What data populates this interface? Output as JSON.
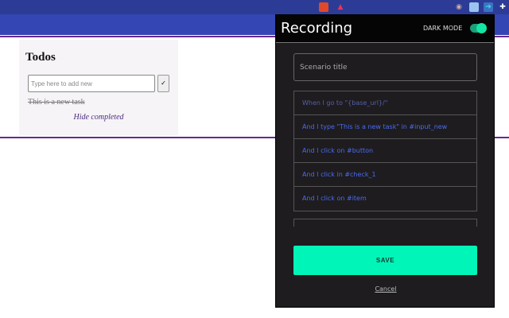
{
  "browser": {
    "extensions": [
      "brave-shield-icon",
      "brave-rewards-icon",
      "extension-icon",
      "extension-icon",
      "recorder-extension-icon",
      "puzzle-icon"
    ]
  },
  "todo": {
    "title": "Todos",
    "input_placeholder": "Type here to add new",
    "add_label": "✓",
    "tasks": [
      {
        "text": "This is a new task",
        "completed": true
      }
    ],
    "hide_completed": "Hide completed"
  },
  "popup": {
    "title": "Recording",
    "dark_mode_label": "DARK MODE",
    "dark_mode_on": true,
    "scenario_placeholder": "Scenario title",
    "steps": [
      "When I go to \"{base_url}/\"",
      "And I type \"This is a new task\" in #input_new",
      "And I click on #button",
      "And I click in #check_1",
      "And I click on #item"
    ],
    "save_label": "SAVE",
    "cancel_label": "Cancel",
    "accent": "#00f5b8"
  }
}
